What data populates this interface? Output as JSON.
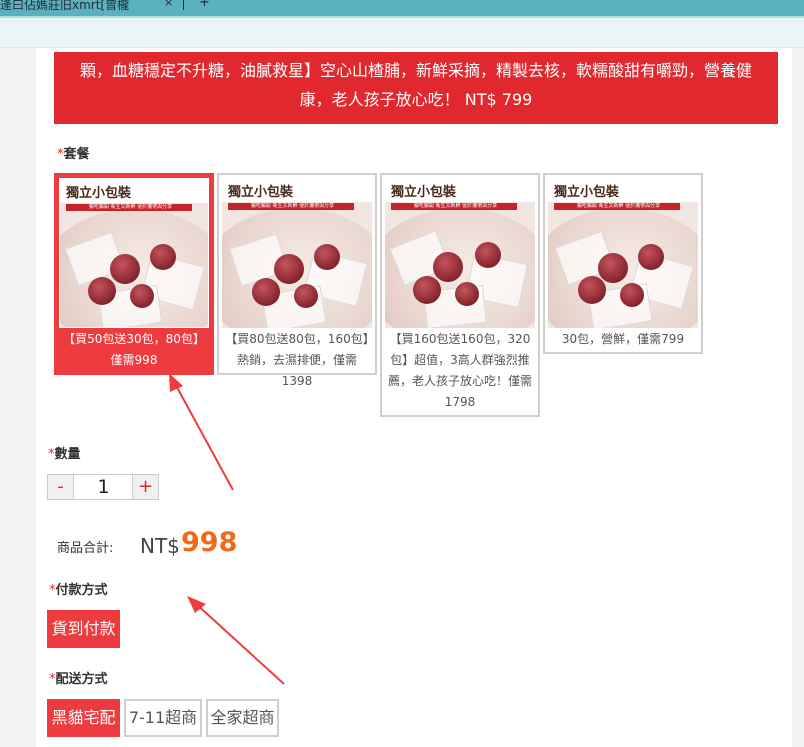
{
  "browser": {
    "tab_title": "逄曰佔媽莊旧xmrt[曾櫳",
    "tab_close": "×",
    "new_tab": "+"
  },
  "product": {
    "banner_line1": "顆，血糖穩定不升糖，油膩救星】空心山楂脯，新鮮采摘，精製去核，軟糯酸甜有嚼勁，營養健",
    "banner_line2": "康，老人孩子放心吃！ NT$ 799"
  },
  "package": {
    "label": "套餐",
    "required_mark": "*",
    "thumb_title": "獨立小包裝",
    "thumb_subtitle": "獨吃獨開 衛生又新鮮 便於攜帶與分享",
    "options": [
      {
        "caption": "【買50包送30包，80包】僅需998",
        "selected": true
      },
      {
        "caption": "【買80包送80包，160包】熱銷，去濕排便，僅需1398",
        "selected": false
      },
      {
        "caption": "【買160包送160包，320包】超值，3高人群強烈推薦，老人孩子放心吃！僅需1798",
        "selected": false
      },
      {
        "caption": "30包，營鮮，僅需799",
        "selected": false
      }
    ]
  },
  "quantity": {
    "label": "數量",
    "required_mark": "*",
    "minus": "-",
    "value": "1",
    "plus": "+"
  },
  "total": {
    "label": "商品合計:",
    "currency": "NT$",
    "amount": "998"
  },
  "payment": {
    "label": "付款方式",
    "required_mark": "*",
    "options": [
      {
        "label": "貨到付款",
        "selected": true
      }
    ]
  },
  "shipping": {
    "label": "配送方式",
    "required_mark": "*",
    "options": [
      {
        "label": "黑貓宅配",
        "selected": true
      },
      {
        "label": "7-11超商",
        "selected": false
      },
      {
        "label": "全家超商",
        "selected": false
      }
    ]
  },
  "colors": {
    "accent_red": "#ee3b3f",
    "banner_red": "#e0282e",
    "price_orange": "#f06a1a",
    "annotation_arrow": "#ee3b3f"
  }
}
